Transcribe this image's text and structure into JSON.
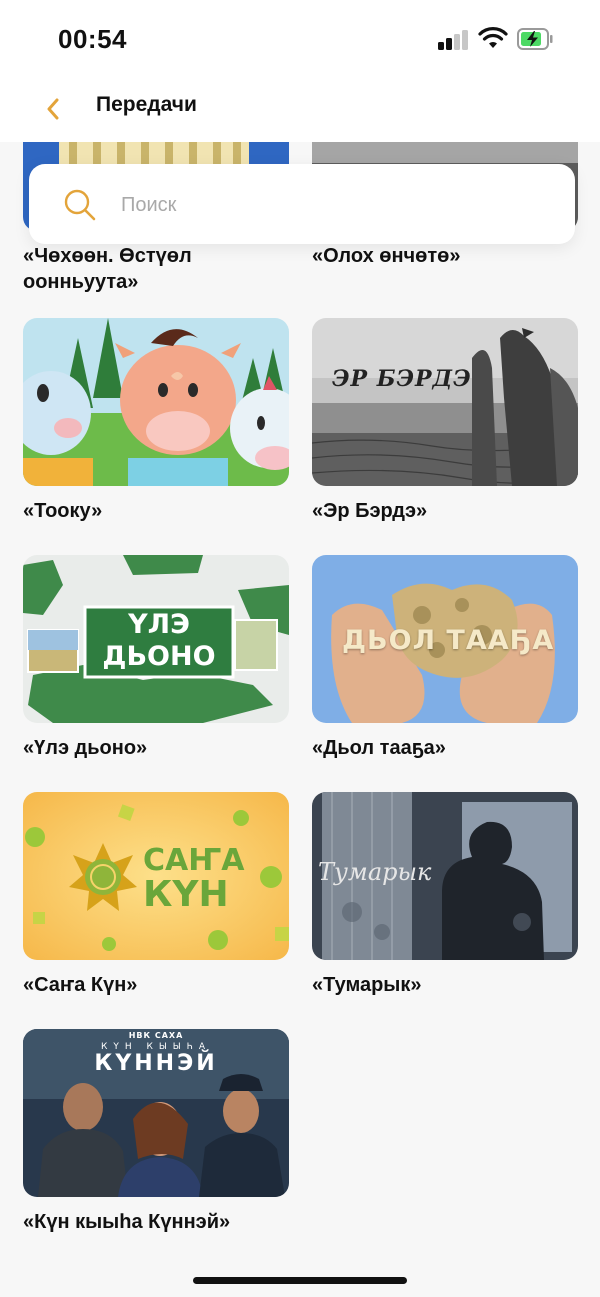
{
  "status_bar": {
    "time": "00:54"
  },
  "nav": {
    "title": "Передачи"
  },
  "search": {
    "placeholder": "Поиск",
    "value": ""
  },
  "shows": [
    {
      "title": "«Чөхөөн. Өстүөл оонньуута»",
      "thumb": "partial-1"
    },
    {
      "title": "«Олох өнчөтө»",
      "thumb": "partial-2"
    },
    {
      "title": "«Тооку»",
      "thumb": "cartoon-calves"
    },
    {
      "title": "«Эр Бэрдэ»",
      "thumb": "eagle-monument",
      "overlay_text": "ЭР БЭРДЭ"
    },
    {
      "title": "«Үлэ дьоно»",
      "thumb": "green-map",
      "overlay_text": [
        "ҮЛЭ",
        "ДЬОНО"
      ]
    },
    {
      "title": "«Дьол тааҕа»",
      "thumb": "hands-stone",
      "overlay_text": "ДЬОЛ ТААҔА"
    },
    {
      "title": "«Саҥа Күн»",
      "thumb": "yellow-sun",
      "overlay_text": [
        "САҤА",
        "КҮН"
      ]
    },
    {
      "title": "«Тумарык»",
      "thumb": "window-silhouette",
      "overlay_text": "Тумарык"
    },
    {
      "title": "«Күн кыыһа Күннэй»",
      "thumb": "drama-poster",
      "overlay_text": [
        "НВК",
        "САХА",
        "КҮН КЫЫҺА",
        "КҮННЭЙ"
      ]
    }
  ],
  "colors": {
    "accent": "#e3a43a",
    "background": "#f7f7f7",
    "battery_green": "#4cd964"
  }
}
